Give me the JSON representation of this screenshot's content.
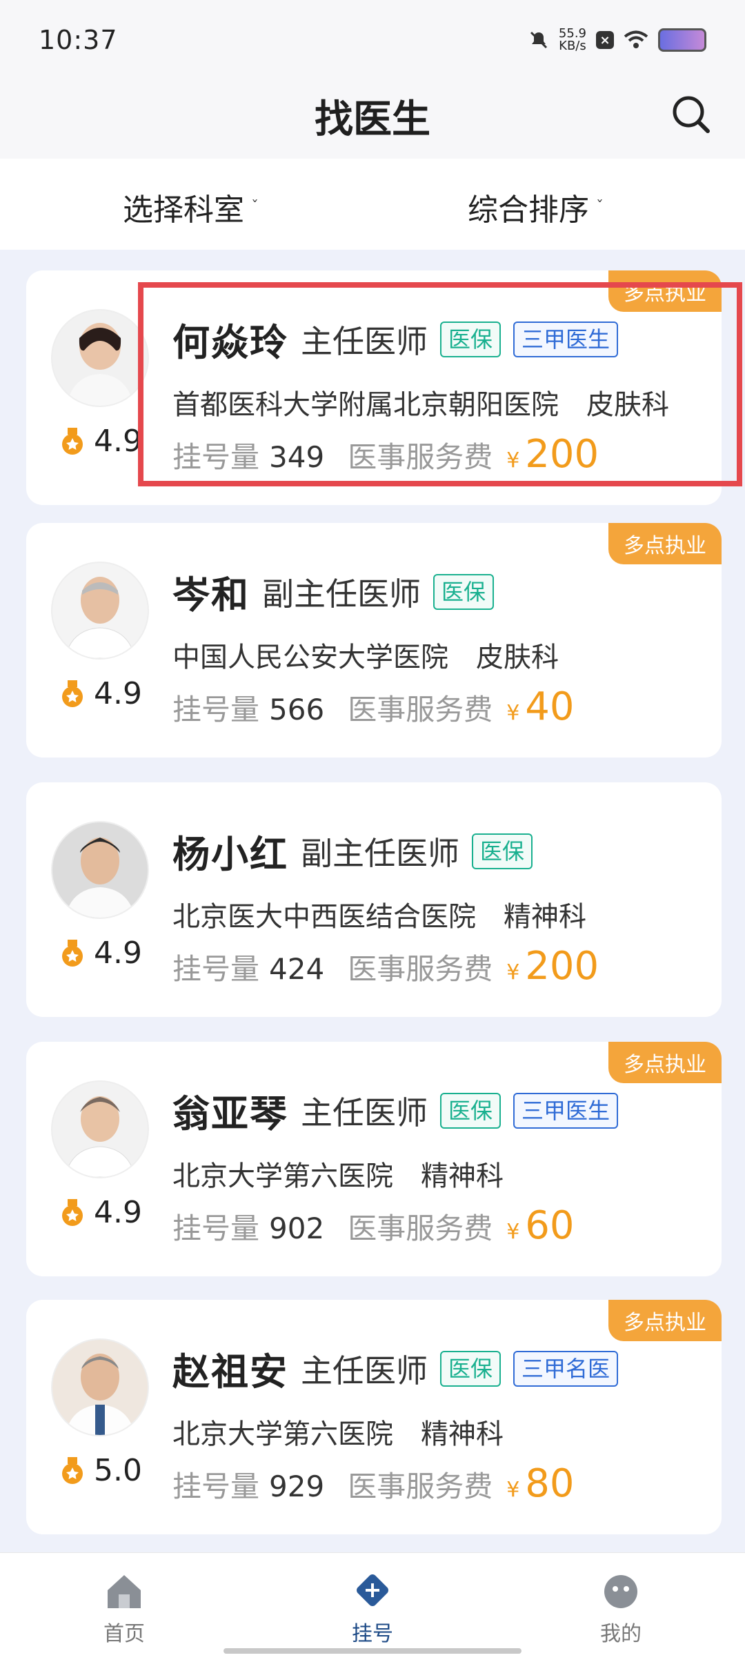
{
  "status": {
    "time": "10:37",
    "net_speed": "55.9",
    "net_unit": "KB/s"
  },
  "header": {
    "title": "找医生"
  },
  "filters": {
    "department": "选择科室",
    "sort": "综合排序"
  },
  "labels": {
    "registrations": "挂号量",
    "service_fee": "医事服务费",
    "yen": "¥"
  },
  "doctors": [
    {
      "name": "何焱玲",
      "title": "主任医师",
      "badges": [
        "医保",
        "三甲医生"
      ],
      "hospital": "首都医科大学附属北京朝阳医院　皮肤科",
      "rating": "4.9",
      "count": "349",
      "price": "200",
      "corner": "多点执业"
    },
    {
      "name": "岑和",
      "title": "副主任医师",
      "badges": [
        "医保"
      ],
      "hospital": "中国人民公安大学医院　皮肤科",
      "rating": "4.9",
      "count": "566",
      "price": "40",
      "corner": "多点执业"
    },
    {
      "name": "杨小红",
      "title": "副主任医师",
      "badges": [
        "医保"
      ],
      "hospital": "北京医大中西医结合医院　精神科",
      "rating": "4.9",
      "count": "424",
      "price": "200",
      "corner": ""
    },
    {
      "name": "翁亚琴",
      "title": "主任医师",
      "badges": [
        "医保",
        "三甲医生"
      ],
      "hospital": "北京大学第六医院　精神科",
      "rating": "4.9",
      "count": "902",
      "price": "60",
      "corner": "多点执业"
    },
    {
      "name": "赵祖安",
      "title": "主任医师",
      "badges": [
        "医保",
        "三甲名医"
      ],
      "hospital": "北京大学第六医院　精神科",
      "rating": "5.0",
      "count": "929",
      "price": "80",
      "corner": "多点执业"
    }
  ],
  "nav": {
    "home": "首页",
    "register": "挂号",
    "mine": "我的"
  },
  "colors": {
    "accent": "#f29b1b",
    "corner_tag": "#f4a53b",
    "badge_green": "#19b08f",
    "badge_blue": "#2f6bd6",
    "highlight": "#e5484d",
    "nav_active": "#1d4a86"
  }
}
